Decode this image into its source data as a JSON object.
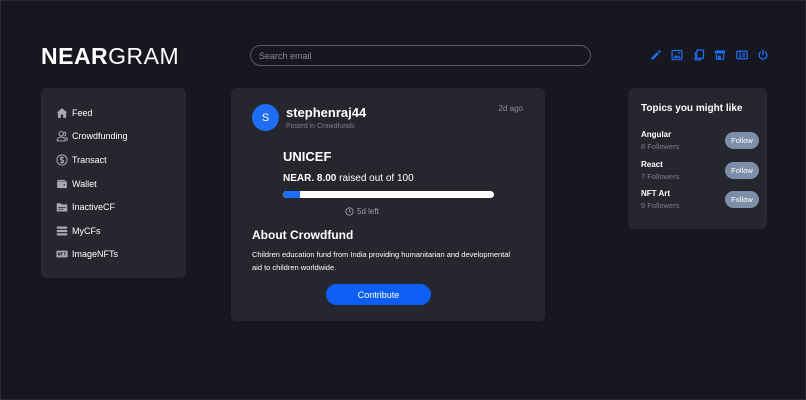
{
  "brand": {
    "bold": "NEAR",
    "light": "GRAM"
  },
  "search": {
    "placeholder": "Search email",
    "value": ""
  },
  "top_icons": [
    "pencil-icon",
    "image-icon",
    "copy-icon",
    "store-icon",
    "id-card-icon",
    "power-icon"
  ],
  "colors": {
    "accent": "#1e6ef5",
    "background": "#171720",
    "card": "#26262e",
    "follow_button": "#7d8fa8"
  },
  "sidebar": {
    "items": [
      {
        "label": "Feed",
        "icon": "home-icon"
      },
      {
        "label": "Crowdfunding",
        "icon": "people-icon"
      },
      {
        "label": "Transact",
        "icon": "dollar-circle-icon"
      },
      {
        "label": "Wallet",
        "icon": "wallet-icon"
      },
      {
        "label": "InactiveCF",
        "icon": "folder-icon"
      },
      {
        "label": "MyCFs",
        "icon": "list-icon"
      },
      {
        "label": "ImageNFTs",
        "icon": "nft-icon"
      }
    ]
  },
  "post": {
    "avatar_initial": "S",
    "username": "stephenraj44",
    "posted_in": "Posted in Crowdfunds",
    "time_ago": "2d ago",
    "title": "UNICEF",
    "raised_amount": "NEAR. 8.00",
    "raised_suffix": "raised out of 100",
    "progress_fraction": 0.08,
    "time_left": "5d left",
    "about_heading": "About Crowdfund",
    "description": "Children education fund from India providing humanitarian and developmental aid to children worldwide.",
    "contribute_label": "Contribute"
  },
  "topics": {
    "title": "Topics you might like",
    "items": [
      {
        "name": "Angular",
        "followers": "8 Followers",
        "button": "Follow"
      },
      {
        "name": "React",
        "followers": "7 Followers",
        "button": "Follow"
      },
      {
        "name": "NFT Art",
        "followers": "9 Followers",
        "button": "Follow"
      }
    ]
  }
}
